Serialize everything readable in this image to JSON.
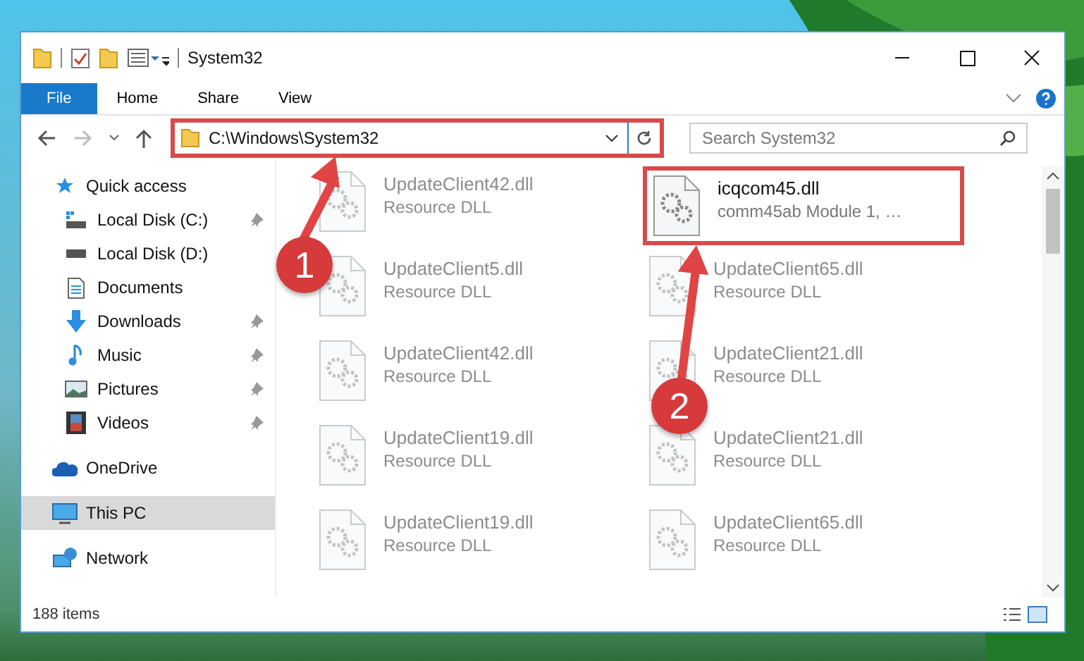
{
  "window": {
    "title": "System32"
  },
  "ribbon": {
    "tabs": [
      {
        "label": "File",
        "kind": "file"
      },
      {
        "label": "Home",
        "kind": "tab"
      },
      {
        "label": "Share",
        "kind": "tab"
      },
      {
        "label": "View",
        "kind": "tab"
      }
    ]
  },
  "address_bar": {
    "path": "C:\\Windows\\System32",
    "highlighted": true
  },
  "search": {
    "placeholder": "Search System32"
  },
  "sidebar": {
    "items": [
      {
        "label": "Quick access",
        "kind": "star",
        "selected": false,
        "children": [
          {
            "label": "Local Disk (C:)",
            "kind": "drive-c",
            "pinned": true,
            "selected": false
          },
          {
            "label": "Local Disk (D:)",
            "kind": "drive",
            "pinned": false,
            "selected": false
          },
          {
            "label": "Documents",
            "kind": "document",
            "pinned": false,
            "selected": false
          },
          {
            "label": "Downloads",
            "kind": "download",
            "pinned": true,
            "selected": false
          },
          {
            "label": "Music",
            "kind": "music",
            "pinned": true,
            "selected": false
          },
          {
            "label": "Pictures",
            "kind": "pictures",
            "pinned": true,
            "selected": false
          },
          {
            "label": "Videos",
            "kind": "videos",
            "pinned": true,
            "selected": false
          }
        ]
      },
      {
        "label": "OneDrive",
        "kind": "cloud",
        "selected": false
      },
      {
        "label": "This PC",
        "kind": "pc",
        "selected": true
      },
      {
        "label": "Network",
        "kind": "network",
        "selected": false
      }
    ]
  },
  "files": [
    {
      "name": "UpdateClient42.dll",
      "description": "Resource DLL",
      "kind": "blurred",
      "highlighted": false
    },
    {
      "name": "icqcom45.dll",
      "description": "comm45ab Module 1, …",
      "kind": "clear",
      "highlighted": true
    },
    {
      "name": "UpdateClient5.dll",
      "description": "Resource DLL",
      "kind": "blurred",
      "highlighted": false
    },
    {
      "name": "UpdateClient65.dll",
      "description": "Resource DLL",
      "kind": "blurred",
      "highlighted": false
    },
    {
      "name": "UpdateClient42.dll",
      "description": "Resource DLL",
      "kind": "blurred",
      "highlighted": false
    },
    {
      "name": "UpdateClient21.dll",
      "description": "Resource DLL",
      "kind": "blurred",
      "highlighted": false
    },
    {
      "name": "UpdateClient19.dll",
      "description": "Resource DLL",
      "kind": "blurred",
      "highlighted": false
    },
    {
      "name": "UpdateClient21.dll",
      "description": "Resource DLL",
      "kind": "blurred",
      "highlighted": false
    },
    {
      "name": "UpdateClient19.dll",
      "description": "Resource DLL",
      "kind": "blurred",
      "highlighted": false
    },
    {
      "name": "UpdateClient65.dll",
      "description": "Resource DLL",
      "kind": "blurred",
      "highlighted": false
    }
  ],
  "status_bar": {
    "item_count": "188 items"
  },
  "annotations": [
    {
      "label": "1"
    },
    {
      "label": "2"
    }
  ]
}
